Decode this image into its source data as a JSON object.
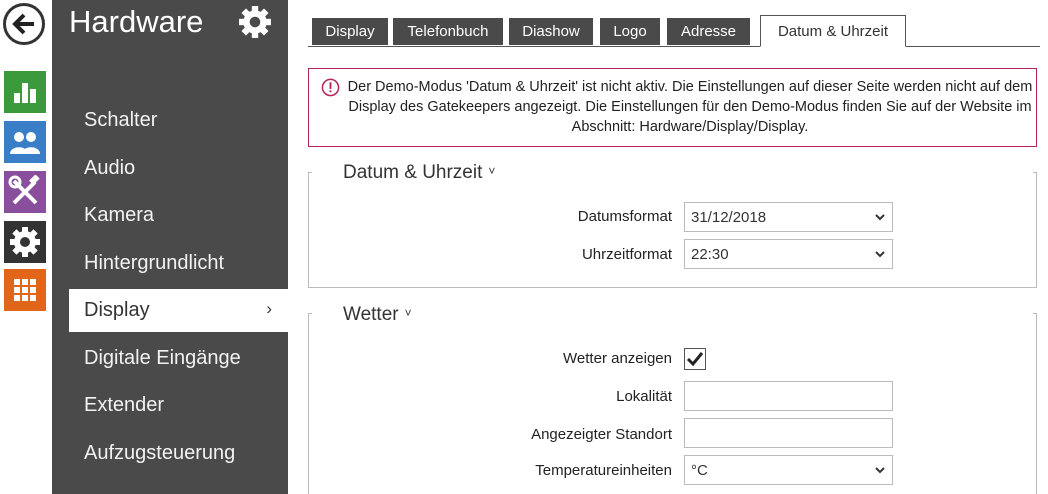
{
  "rail": {
    "back_icon": "arrow-left-icon",
    "items": [
      {
        "icon": "bar-chart-icon",
        "color": "#3c9a3c"
      },
      {
        "icon": "users-icon",
        "color": "#3a7ec8"
      },
      {
        "icon": "tools-icon",
        "color": "#8a4f9c"
      },
      {
        "icon": "gear-icon",
        "color": "#333333"
      },
      {
        "icon": "grid-icon",
        "color": "#e2661a"
      }
    ]
  },
  "sidebar": {
    "title": "Hardware",
    "items": [
      {
        "label": "Schalter"
      },
      {
        "label": "Audio"
      },
      {
        "label": "Kamera"
      },
      {
        "label": "Hintergrundlicht"
      },
      {
        "label": "Display",
        "active": true,
        "chevron": "›"
      },
      {
        "label": "Digitale Eingänge"
      },
      {
        "label": "Extender"
      },
      {
        "label": "Aufzugsteuerung"
      }
    ]
  },
  "tabs": [
    {
      "label": "Display"
    },
    {
      "label": "Telefonbuch"
    },
    {
      "label": "Diashow"
    },
    {
      "label": "Logo"
    },
    {
      "label": "Adresse"
    },
    {
      "label": "Datum & Uhrzeit",
      "active": true
    }
  ],
  "alert": {
    "text": "Der Demo-Modus 'Datum & Uhrzeit' ist nicht aktiv. Die Einstellungen auf dieser Seite werden nicht auf dem Display des Gatekeepers angezeigt. Die Einstellungen für den Demo-Modus finden Sie auf der Website im Abschnitt: Hardware/Display/Display.",
    "color": "#b5245a"
  },
  "datetime_section": {
    "title": "Datum & Uhrzeit",
    "caret": "˅",
    "date_format_label": "Datumsformat",
    "date_format_value": "31/12/2018",
    "time_format_label": "Uhrzeitformat",
    "time_format_value": "22:30"
  },
  "weather_section": {
    "title": "Wetter",
    "caret": "˅",
    "show_weather_label": "Wetter anzeigen",
    "show_weather_checked": true,
    "locality_label": "Lokalität",
    "locality_value": "",
    "displayed_location_label": "Angezeigter Standort",
    "displayed_location_value": "",
    "temp_units_label": "Temperatureinheiten",
    "temp_units_value": "°C"
  }
}
